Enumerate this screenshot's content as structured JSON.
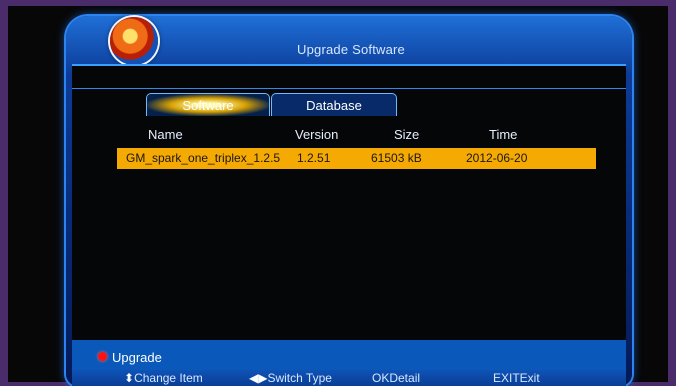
{
  "header": {
    "title": "Upgrade Software"
  },
  "tabs": [
    {
      "label": "Software",
      "active": true
    },
    {
      "label": "Database",
      "active": false
    }
  ],
  "table": {
    "columns": [
      "Name",
      "Version",
      "Size",
      "Time"
    ],
    "rows": [
      {
        "name": "GM_spark_one_triplex_1.2.5",
        "version": "1.2.51",
        "size": "61503 kB",
        "time": "2012-06-20"
      }
    ]
  },
  "footer": {
    "upgrade_label": "Upgrade",
    "hints": [
      {
        "icon": "up-down-arrow-icon",
        "label": "Change Item"
      },
      {
        "icon": "left-right-arrow-icon",
        "label": "Switch Type"
      },
      {
        "key": "OK",
        "label": "Detail"
      },
      {
        "key": "EXIT",
        "label": "Exit"
      }
    ]
  },
  "colors": {
    "accent": "#1f6fd7",
    "selected_row": "#f5aa03",
    "active_tab": "#d59f04",
    "upgrade_dot": "#ff1212"
  }
}
